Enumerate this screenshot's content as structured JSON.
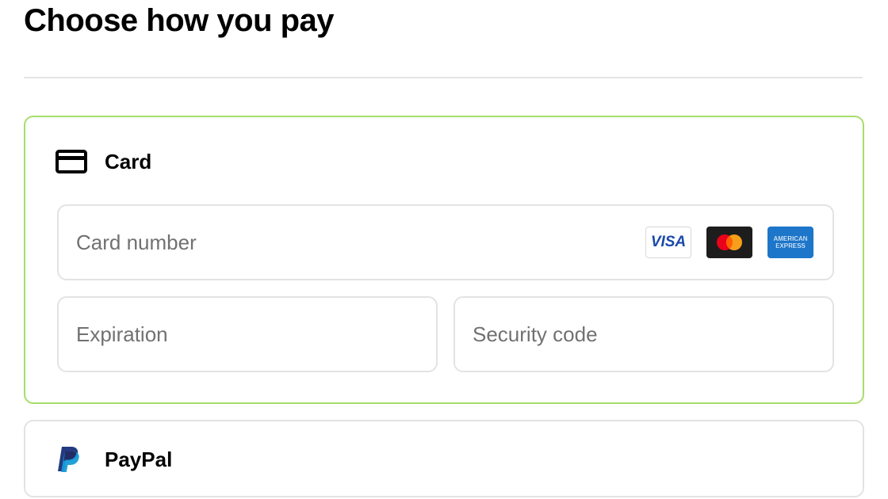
{
  "page": {
    "title": "Choose how you pay"
  },
  "card_method": {
    "label": "Card",
    "icon": "credit-card-icon",
    "selected": true,
    "accent_color": "#a6dd6a",
    "card_number": {
      "placeholder": "Card number",
      "value": ""
    },
    "expiration": {
      "placeholder": "Expiration",
      "value": ""
    },
    "security_code": {
      "placeholder": "Security code",
      "value": ""
    },
    "brands": [
      {
        "name": "visa-logo",
        "text": "VISA"
      },
      {
        "name": "mastercard-logo"
      },
      {
        "name": "amex-logo",
        "text_line1": "AMERICAN",
        "text_line2": "EXPRESS"
      }
    ]
  },
  "paypal_method": {
    "label": "PayPal",
    "icon": "paypal-icon",
    "selected": false
  }
}
